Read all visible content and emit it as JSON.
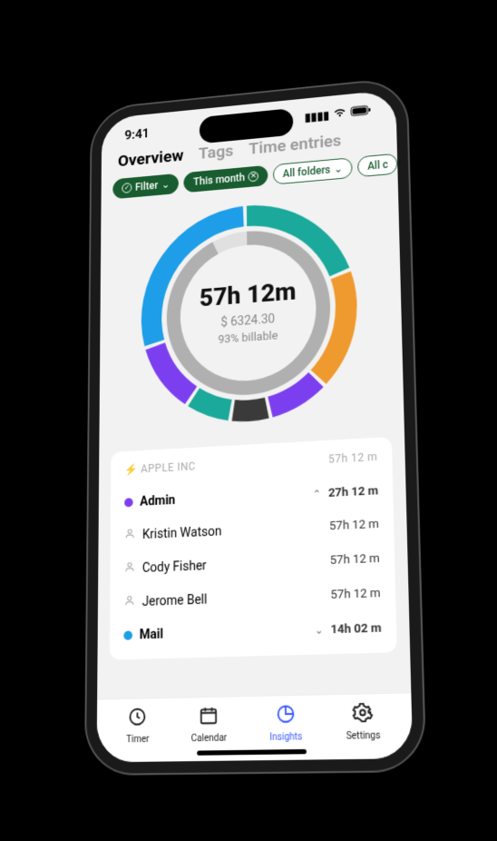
{
  "status": {
    "time": "9:41"
  },
  "tabs": {
    "overview": "Overview",
    "tags": "Tags",
    "entries": "Time entries"
  },
  "filters": {
    "filter": "Filter",
    "period": "This month",
    "folders": "All folders",
    "extra": "All c"
  },
  "summary": {
    "time": "57h 12m",
    "amount": "$ 6324.30",
    "billable": "93% billable"
  },
  "chart_data": {
    "type": "pie",
    "title": "",
    "series_outer": [
      {
        "name": "Teal A",
        "color": "#1aa99a",
        "value": 20
      },
      {
        "name": "Orange",
        "color": "#ef9a2f",
        "value": 18
      },
      {
        "name": "Purple A",
        "color": "#7b3ff0",
        "value": 9
      },
      {
        "name": "Dark",
        "color": "#3a3a3a",
        "value": 6
      },
      {
        "name": "Teal B",
        "color": "#1aa99a",
        "value": 7
      },
      {
        "name": "Purple B",
        "color": "#7b3ff0",
        "value": 11
      },
      {
        "name": "Blue",
        "color": "#1e9ee8",
        "value": 29
      }
    ],
    "series_inner": [
      {
        "name": "Billable",
        "color": "#b0b0b0",
        "value": 93
      },
      {
        "name": "Non-billable",
        "color": "#e0e0e0",
        "value": 7
      }
    ]
  },
  "client": {
    "name": "APPLE INC",
    "total": "57h 12 m"
  },
  "projects": [
    {
      "name": "Admin",
      "color": "purple",
      "expanded": true,
      "duration": "27h 12 m",
      "people": [
        {
          "name": "Kristin Watson",
          "duration": "57h 12 m"
        },
        {
          "name": "Cody Fisher",
          "duration": "57h 12 m"
        },
        {
          "name": "Jerome Bell",
          "duration": "57h 12 m"
        }
      ]
    },
    {
      "name": "Mail",
      "color": "blue",
      "expanded": false,
      "duration": "14h 02 m",
      "people": []
    }
  ],
  "nav": {
    "timer": "Timer",
    "calendar": "Calendar",
    "insights": "Insights",
    "settings": "Settings"
  }
}
